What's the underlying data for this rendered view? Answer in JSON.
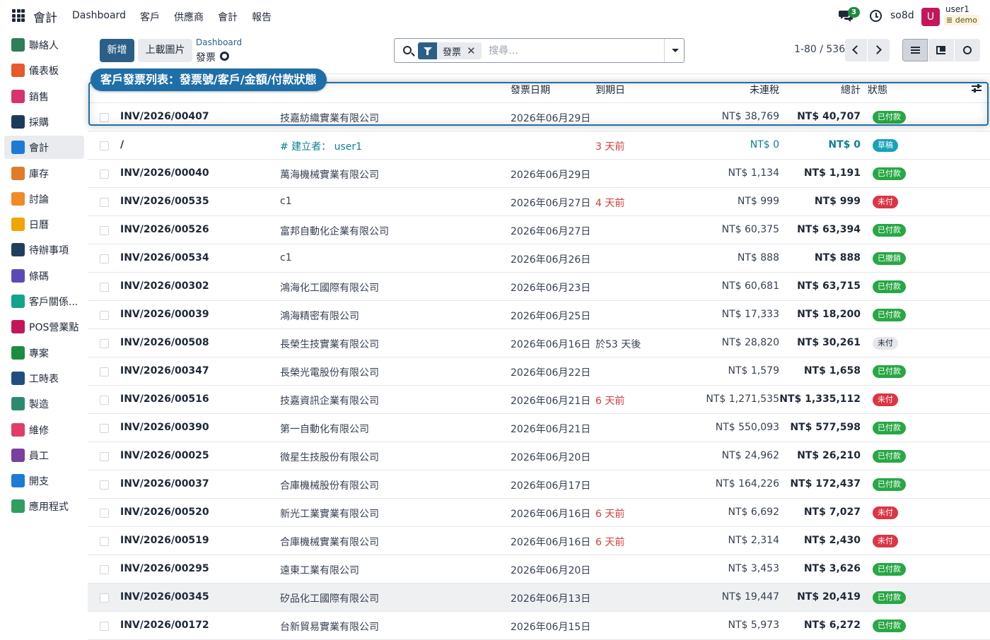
{
  "topbar": {
    "app_title": "會計",
    "menu": [
      "Dashboard",
      "客戶",
      "供應商",
      "會計",
      "報告"
    ],
    "chat_count": "3",
    "company": "so8d",
    "avatar_letter": "U",
    "user_name": "user1",
    "db_name": "demo"
  },
  "sidebar": {
    "items": [
      {
        "label": "聯絡人",
        "icon": "contacts-icon",
        "color": "#2e7d5b"
      },
      {
        "label": "儀表板",
        "icon": "dashboard-icon",
        "color": "#e65a2b"
      },
      {
        "label": "銷售",
        "icon": "sales-icon",
        "color": "#d6336c"
      },
      {
        "label": "採購",
        "icon": "purchase-icon",
        "color": "#1a3b5c"
      },
      {
        "label": "會計",
        "icon": "accounting-icon",
        "color": "#1f7ad6"
      },
      {
        "label": "庫存",
        "icon": "inventory-icon",
        "color": "#e07b2a"
      },
      {
        "label": "討論",
        "icon": "discuss-icon",
        "color": "#f08a24"
      },
      {
        "label": "日曆",
        "icon": "calendar-icon",
        "color": "#f0a500"
      },
      {
        "label": "待辦事項",
        "icon": "todo-icon",
        "color": "#1f3f5c"
      },
      {
        "label": "條碼",
        "icon": "barcode-icon",
        "color": "#5b4bb7"
      },
      {
        "label": "客戶關係...",
        "icon": "crm-icon",
        "color": "#14a38b"
      },
      {
        "label": "POS營業點",
        "icon": "pos-icon",
        "color": "#c2185b"
      },
      {
        "label": "專案",
        "icon": "project-icon",
        "color": "#1e8c3e"
      },
      {
        "label": "工時表",
        "icon": "timesheet-icon",
        "color": "#1f4f80"
      },
      {
        "label": "製造",
        "icon": "manufacturing-icon",
        "color": "#2c8a6e"
      },
      {
        "label": "維修",
        "icon": "repair-icon",
        "color": "#e23d6a"
      },
      {
        "label": "員工",
        "icon": "employees-icon",
        "color": "#7b3fa0"
      },
      {
        "label": "開支",
        "icon": "expenses-icon",
        "color": "#1f7ad6"
      },
      {
        "label": "應用程式",
        "icon": "apps-icon",
        "color": "#2f9e5f"
      }
    ],
    "active_index": 4
  },
  "control": {
    "new_label": "新增",
    "upload_label": "上載圖片",
    "breadcrumb": "Dashboard",
    "current": "發票",
    "facet_label": "發票",
    "search_placeholder": "搜尋…",
    "pager": "1-80 / 536"
  },
  "table": {
    "headers": {
      "invoice_date": "發票日期",
      "due_date": "到期日",
      "untaxed": "未連稅",
      "total": "總計",
      "status": "狀態"
    },
    "rows": [
      {
        "number": "INV/2026/00407",
        "customer": "技嘉紡織實業有限公司",
        "date": "2026年06月29日",
        "due": "",
        "due_red": false,
        "untaxed": "NT$ 38,769",
        "total": "NT$ 40,707",
        "status": "已付款",
        "status_kind": "paid"
      },
      {
        "number": "/",
        "customer": "# 建立者： user1",
        "customer_link": true,
        "date": "",
        "due": "3 天前",
        "due_red": true,
        "untaxed": "NT$ 0",
        "untaxed_link": true,
        "total": "NT$ 0",
        "total_link": true,
        "status": "草稿",
        "status_kind": "draft"
      },
      {
        "number": "INV/2026/00040",
        "customer": "萬海機械實業有限公司",
        "date": "2026年06月29日",
        "due": "",
        "due_red": false,
        "untaxed": "NT$ 1,134",
        "total": "NT$ 1,191",
        "status": "已付款",
        "status_kind": "paid"
      },
      {
        "number": "INV/2026/00535",
        "customer": "c1",
        "date": "2026年06月27日",
        "due": "4 天前",
        "due_red": true,
        "untaxed": "NT$ 999",
        "total": "NT$ 999",
        "status": "未付",
        "status_kind": "unpaid"
      },
      {
        "number": "INV/2026/00526",
        "customer": "富邦自動化企業有限公司",
        "date": "2026年06月27日",
        "due": "",
        "due_red": false,
        "untaxed": "NT$ 60,375",
        "total": "NT$ 63,394",
        "status": "已付款",
        "status_kind": "paid"
      },
      {
        "number": "INV/2026/00534",
        "customer": "c1",
        "date": "2026年06月26日",
        "due": "",
        "due_red": false,
        "untaxed": "NT$ 888",
        "total": "NT$ 888",
        "status": "已撤銷",
        "status_kind": "reversed"
      },
      {
        "number": "INV/2026/00302",
        "customer": "鴻海化工國際有限公司",
        "date": "2026年06月23日",
        "due": "",
        "due_red": false,
        "untaxed": "NT$ 60,681",
        "total": "NT$ 63,715",
        "status": "已付款",
        "status_kind": "paid"
      },
      {
        "number": "INV/2026/00039",
        "customer": "鴻海精密有限公司",
        "date": "2026年06月25日",
        "due": "",
        "due_red": false,
        "untaxed": "NT$ 17,333",
        "total": "NT$ 18,200",
        "status": "已付款",
        "status_kind": "paid"
      },
      {
        "number": "INV/2026/00508",
        "customer": "長榮生技實業有限公司",
        "date": "2026年06月16日",
        "due": "於53 天後",
        "due_red": false,
        "untaxed": "NT$ 28,820",
        "total": "NT$ 30,261",
        "status": "未付",
        "status_kind": "grey"
      },
      {
        "number": "INV/2026/00347",
        "customer": "長榮光電股份有限公司",
        "date": "2026年06月22日",
        "due": "",
        "due_red": false,
        "untaxed": "NT$ 1,579",
        "total": "NT$ 1,658",
        "status": "已付款",
        "status_kind": "paid"
      },
      {
        "number": "INV/2026/00516",
        "customer": "技嘉資訊企業有限公司",
        "date": "2026年06月21日",
        "due": "6 天前",
        "due_red": true,
        "untaxed": "NT$ 1,271,535",
        "total": "NT$ 1,335,112",
        "status": "未付",
        "status_kind": "unpaid"
      },
      {
        "number": "INV/2026/00390",
        "customer": "第一自動化有限公司",
        "date": "2026年06月21日",
        "due": "",
        "due_red": false,
        "untaxed": "NT$ 550,093",
        "total": "NT$ 577,598",
        "status": "已付款",
        "status_kind": "paid"
      },
      {
        "number": "INV/2026/00025",
        "customer": "微星生技股份有限公司",
        "date": "2026年06月20日",
        "due": "",
        "due_red": false,
        "untaxed": "NT$ 24,962",
        "total": "NT$ 26,210",
        "status": "已付款",
        "status_kind": "paid"
      },
      {
        "number": "INV/2026/00037",
        "customer": "合庫機械股份有限公司",
        "date": "2026年06月17日",
        "due": "",
        "due_red": false,
        "untaxed": "NT$ 164,226",
        "total": "NT$ 172,437",
        "status": "已付款",
        "status_kind": "paid"
      },
      {
        "number": "INV/2026/00520",
        "customer": "新光工業實業有限公司",
        "date": "2026年06月16日",
        "due": "6 天前",
        "due_red": true,
        "untaxed": "NT$ 6,692",
        "total": "NT$ 7,027",
        "status": "未付",
        "status_kind": "unpaid"
      },
      {
        "number": "INV/2026/00519",
        "customer": "合庫機械實業有限公司",
        "date": "2026年06月16日",
        "due": "6 天前",
        "due_red": true,
        "untaxed": "NT$ 2,314",
        "total": "NT$ 2,430",
        "status": "未付",
        "status_kind": "unpaid"
      },
      {
        "number": "INV/2026/00295",
        "customer": "遠東工業有限公司",
        "date": "2026年06月20日",
        "due": "",
        "due_red": false,
        "untaxed": "NT$ 3,453",
        "total": "NT$ 3,626",
        "status": "已付款",
        "status_kind": "paid"
      },
      {
        "number": "INV/2026/00345",
        "customer": "矽品化工國際有限公司",
        "date": "2026年06月13日",
        "due": "",
        "due_red": false,
        "untaxed": "NT$ 19,447",
        "total": "NT$ 20,419",
        "status": "已付款",
        "status_kind": "paid",
        "highlight": true
      },
      {
        "number": "INV/2026/00172",
        "customer": "台新貿易實業有限公司",
        "date": "2026年06月15日",
        "due": "",
        "due_red": false,
        "untaxed": "NT$ 5,973",
        "total": "NT$ 6,272",
        "status": "已付款",
        "status_kind": "paid"
      }
    ]
  },
  "callout": {
    "label": "客戶發票列表：發票號/客戶/金額/付款狀態"
  }
}
